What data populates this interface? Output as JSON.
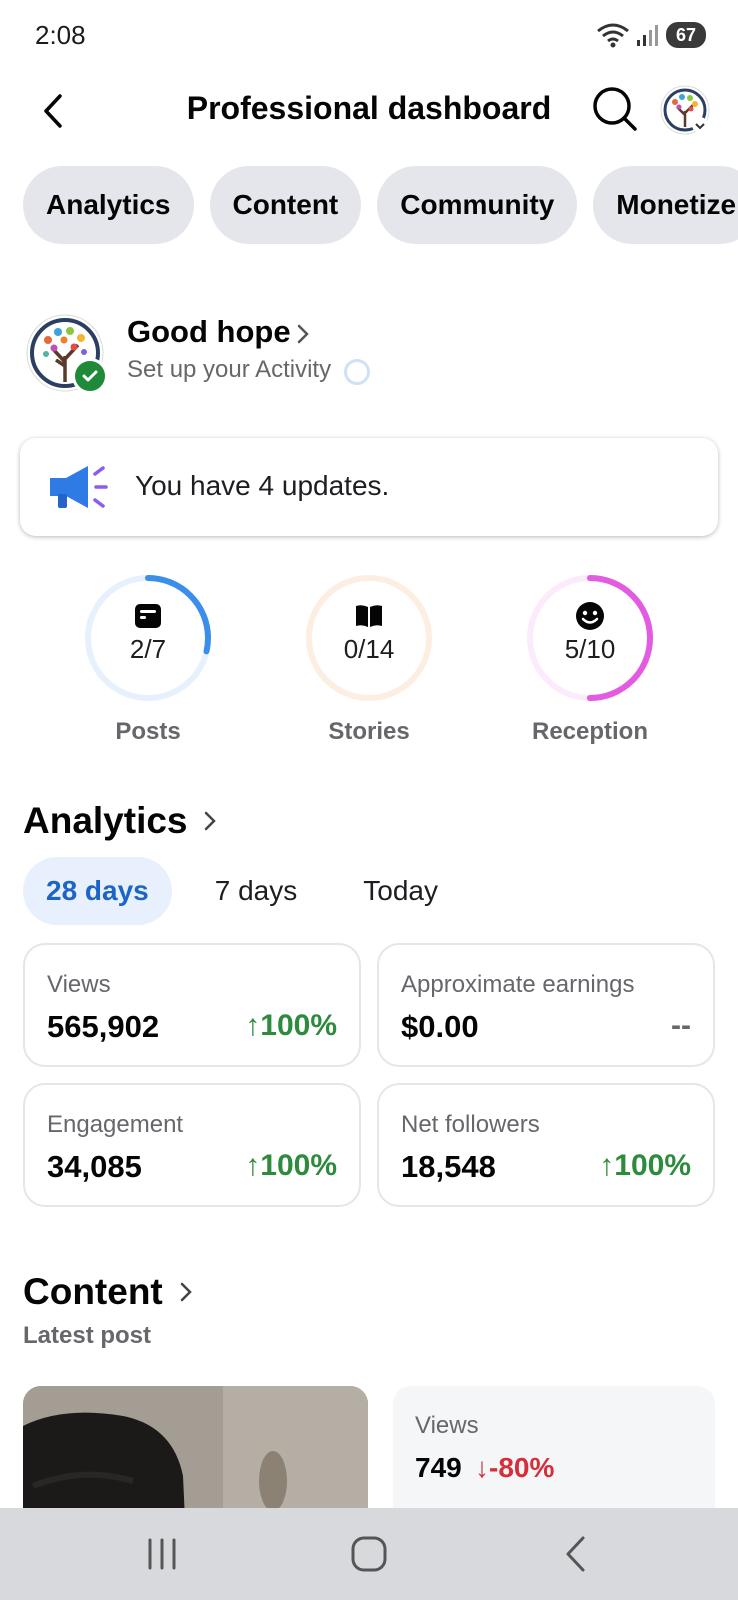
{
  "status": {
    "time": "2:08",
    "battery": "67"
  },
  "header": {
    "title": "Professional dashboard"
  },
  "chips": [
    "Analytics",
    "Content",
    "Community",
    "Monetize"
  ],
  "profile": {
    "name": "Good hope",
    "subtitle": "Set up your Activity"
  },
  "updates": {
    "text": "You have 4 updates."
  },
  "progress_rings": [
    {
      "label": "Posts",
      "value": "2/7",
      "fraction": 0.2857,
      "color": "#3b8eea",
      "track": "#e7f1fd",
      "icon": "post-icon"
    },
    {
      "label": "Stories",
      "value": "0/14",
      "fraction": 0,
      "color": "#f4a062",
      "track": "#fdeee2",
      "icon": "book-icon"
    },
    {
      "label": "Reception",
      "value": "5/10",
      "fraction": 0.5,
      "color": "#e35be0",
      "track": "#fcebfb",
      "icon": "smiley-icon"
    }
  ],
  "analytics": {
    "title": "Analytics",
    "ranges": [
      "28 days",
      "7 days",
      "Today"
    ],
    "active_range": "28 days",
    "cards": [
      {
        "label": "Views",
        "value": "565,902",
        "change": "100%",
        "direction": "up"
      },
      {
        "label": "Approximate earnings",
        "value": "$0.00",
        "change": "--",
        "direction": "none"
      },
      {
        "label": "Engagement",
        "value": "34,085",
        "change": "100%",
        "direction": "up"
      },
      {
        "label": "Net followers",
        "value": "18,548",
        "change": "100%",
        "direction": "up"
      }
    ]
  },
  "content": {
    "title": "Content",
    "latest_label": "Latest post",
    "post": {
      "views_label": "Views",
      "views_value": "749",
      "views_change": "-80%"
    }
  },
  "colors": {
    "accent": "#1b64c8",
    "positive": "#2e8b3d",
    "negative": "#d42f3a"
  }
}
